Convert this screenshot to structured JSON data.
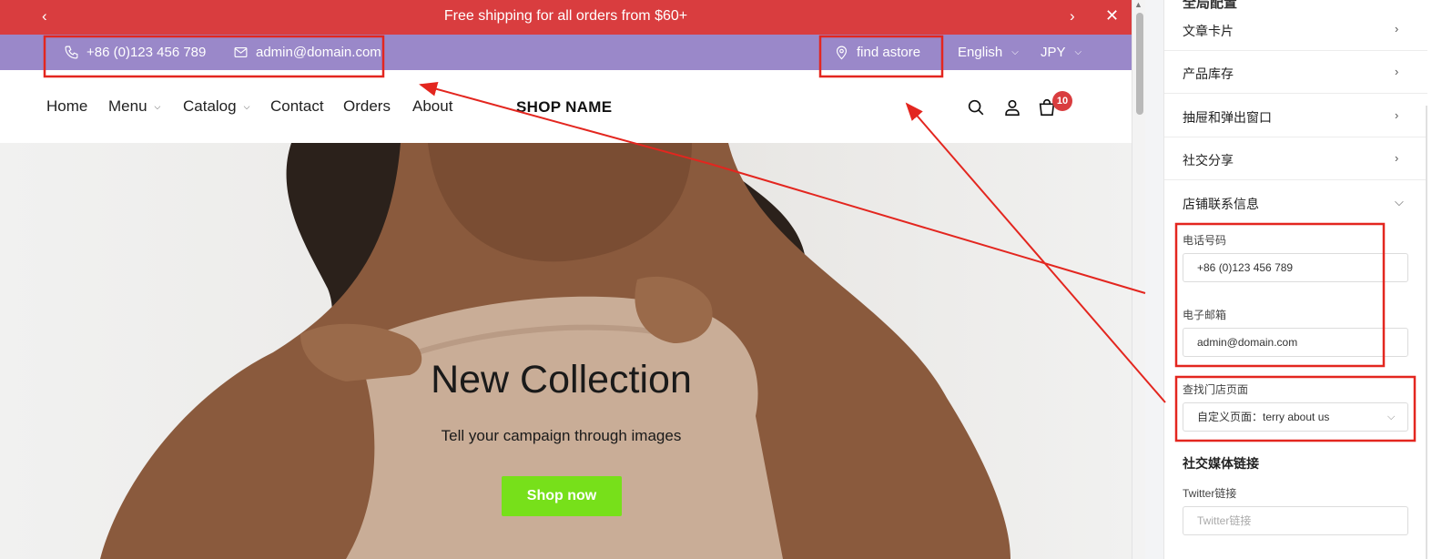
{
  "announcement": {
    "text": "Free shipping for all orders from $60+",
    "prev_glyph": "‹",
    "next_glyph": "›",
    "close_glyph": "✕"
  },
  "topbar": {
    "phone": "+86 (0)123 456 789",
    "email": "admin@domain.com",
    "store": "find astore",
    "language": "English",
    "currency": "JPY"
  },
  "nav": {
    "home": "Home",
    "menu": "Menu",
    "catalog": "Catalog",
    "contact": "Contact",
    "orders": "Orders",
    "about": "About",
    "shop_name": "SHOP NAME",
    "cart_count": "10"
  },
  "hero": {
    "title": "New Collection",
    "subtitle": "Tell your campaign through images",
    "button": "Shop now"
  },
  "panel": {
    "heading": "全局配置",
    "rows": [
      "文章卡片",
      "产品库存",
      "抽屉和弹出窗口",
      "社交分享",
      "店铺联系信息"
    ],
    "phone_label": "电话号码",
    "phone_value": "+86 (0)123 456 789",
    "email_label": "电子邮箱",
    "email_value": "admin@domain.com",
    "store_label": "查找门店页面",
    "store_value": "自定义页面：terry about us",
    "social_heading": "社交媒体链接",
    "twitter_label": "Twitter链接",
    "twitter_placeholder": "Twitter链接"
  },
  "colors": {
    "announcement_bg": "#d93d3f",
    "topbar_bg": "#9a88c9",
    "cta_bg": "#77e01a",
    "annotation": "#e3261f"
  },
  "icons": [
    "phone-icon",
    "mail-icon",
    "location-pin-icon",
    "search-icon",
    "user-icon",
    "bag-icon",
    "chevron-right-icon",
    "chevron-down-icon"
  ]
}
